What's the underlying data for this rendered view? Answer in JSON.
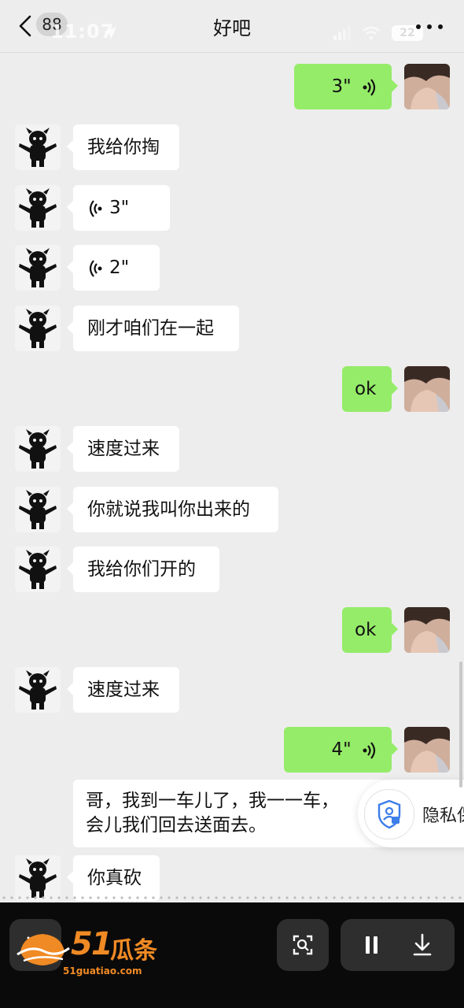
{
  "header": {
    "back_badge": "88",
    "status_time": "11:07",
    "battery": "22",
    "title": "好吧"
  },
  "messages": [
    {
      "side": "out",
      "kind": "voice",
      "text": "3\""
    },
    {
      "side": "in",
      "kind": "text",
      "text": "我给你掏"
    },
    {
      "side": "in",
      "kind": "voice",
      "text": "3\""
    },
    {
      "side": "in",
      "kind": "voice",
      "text": "2\""
    },
    {
      "side": "in",
      "kind": "text",
      "text": "刚才咱们在一起"
    },
    {
      "side": "out",
      "kind": "text",
      "text": "ok"
    },
    {
      "side": "in",
      "kind": "text",
      "text": "速度过来"
    },
    {
      "side": "in",
      "kind": "text",
      "text": "你就说我叫你出来的"
    },
    {
      "side": "in",
      "kind": "text",
      "text": "我给你们开的"
    },
    {
      "side": "out",
      "kind": "text",
      "text": "ok"
    },
    {
      "side": "in",
      "kind": "text",
      "text": "速度过来"
    },
    {
      "side": "out",
      "kind": "voice",
      "text": "4\""
    },
    {
      "side": "in",
      "kind": "text",
      "line1": "哥，我到一车儿了，我一一车，",
      "line2": "会儿我们回去送面去。"
    },
    {
      "side": "in",
      "kind": "text",
      "text": "你真砍"
    }
  ],
  "privacy": {
    "label": "隐私保"
  },
  "watermark": {
    "number": "51",
    "name": "瓜条",
    "url": "51guatiao.com"
  },
  "colors": {
    "background": "#ededed",
    "bubble_out": "#95ec69",
    "bubble_in": "#ffffff",
    "watermark": "#f08a24"
  }
}
